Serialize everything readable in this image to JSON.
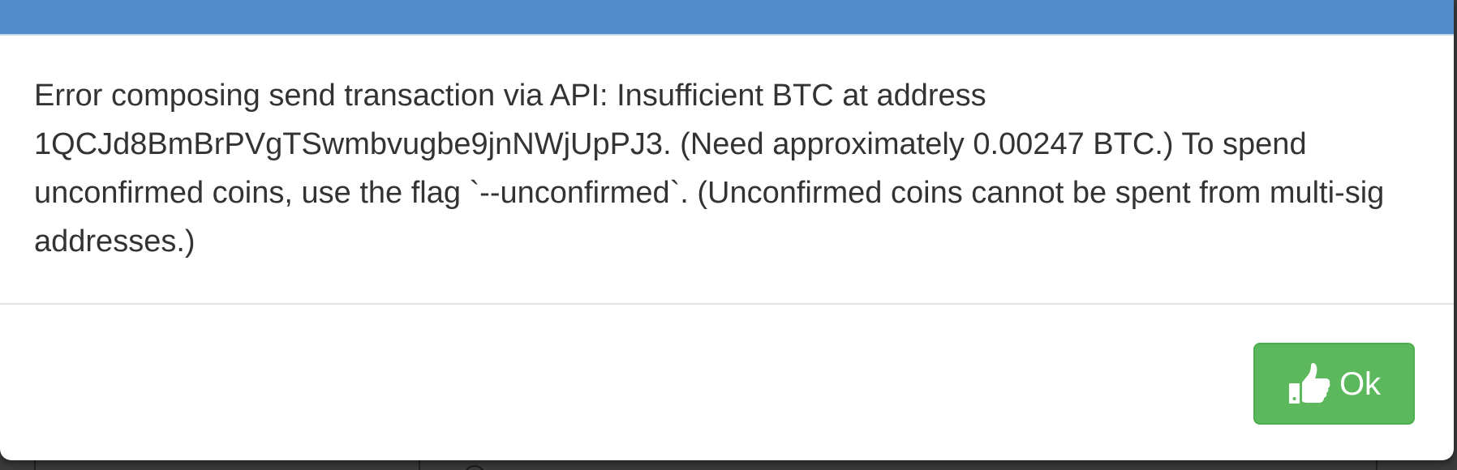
{
  "dialog": {
    "message": "Error composing send transaction via API: Insufficient BTC at address 1QCJd8BmBrPVgTSwmbvugbe9jnNWjUpPJ3. (Need approximately 0.00247 BTC.) To spend unconfirmed coins, use the flag `--unconfirmed`. (Unconfirmed coins cannot be spent from multi-sig addresses.)",
    "ok_button": {
      "label": "Ok",
      "icon": "thumbs-up-icon"
    }
  },
  "colors": {
    "header": "#538ccb",
    "ok_button": "#5cb85c",
    "text": "#333333"
  }
}
